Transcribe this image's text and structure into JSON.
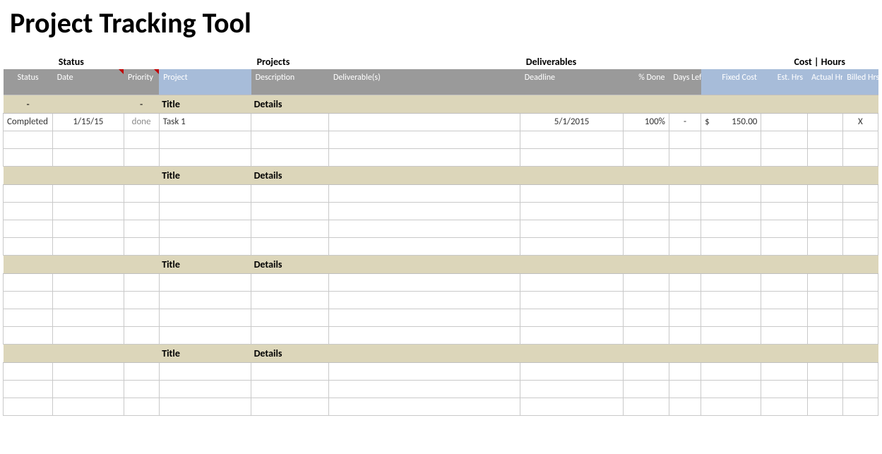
{
  "title": "Project Tracking Tool",
  "groups": {
    "status": "Status",
    "projects": "Projects",
    "deliverables": "Deliverables",
    "cost_hours": "Cost | Hours"
  },
  "headers": {
    "status": "Status",
    "date": "Date",
    "priority": "Priority",
    "project": "Project",
    "description": "Description",
    "deliverables": "Deliverable(s)",
    "deadline": "Deadline",
    "pct_done": "% Done",
    "days_left": "Days Left",
    "fixed_cost": "Fixed Cost",
    "est_hrs": "Est. Hrs",
    "actual_hrs": "Actual Hrs",
    "billed_hrs": "Billed Hrs"
  },
  "section": {
    "title": "Title",
    "details": "Details",
    "dash": "-"
  },
  "rows": [
    {
      "status": "Completed",
      "date": "1/15/15",
      "priority": "done",
      "project": "Task 1",
      "description": "",
      "deliverables": "",
      "deadline": "5/1/2015",
      "pct_done": "100%",
      "days_left": "-",
      "fixed_cost_sym": "$",
      "fixed_cost_val": "150.00",
      "est_hrs": "",
      "actual_hrs": "",
      "billed_hrs": "X"
    }
  ]
}
